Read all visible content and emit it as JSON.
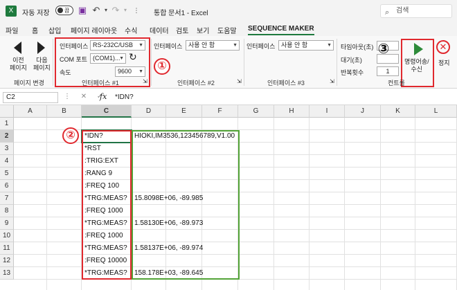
{
  "titlebar": {
    "autosave_label": "자동 저장",
    "autosave_state": "끔",
    "doc_title": "통합 문서1 - Excel",
    "search_placeholder": "검색"
  },
  "menu": [
    "파일",
    "홈",
    "삽입",
    "페이지 레이아웃",
    "수식",
    "데이터",
    "검토",
    "보기",
    "도움말",
    "SEQUENCE MAKER"
  ],
  "ribbon": {
    "nav": {
      "prev": "이전\n페이지",
      "next": "다음\n페이지",
      "group": "페이지 변경"
    },
    "if1": {
      "interface_label": "인터페이스",
      "interface_value": "RS-232C/USB",
      "com_label": "COM 포트",
      "com_value": "(COM1)...",
      "speed_label": "속도",
      "speed_value": "9600",
      "group": "인터페이스 #1"
    },
    "if2": {
      "interface_label": "인터페이스",
      "interface_value": "사용 안 함",
      "group": "인터페이스 #2"
    },
    "if3": {
      "interface_label": "인터페이스",
      "interface_value": "사용 안 함",
      "group": "인터페이스 #3"
    },
    "control": {
      "timeout_label": "타임아웃(초)",
      "wait_label": "대기(초)",
      "repeat_label": "반복횟수",
      "repeat_value": "1",
      "send_label": "명령어송/\n수신",
      "stop_label": "정지",
      "group": "컨트롤"
    },
    "markers": {
      "m1": "①",
      "m2": "②",
      "m3": "③"
    }
  },
  "formula": {
    "cell_ref": "C2",
    "fx": "fx",
    "value": "*IDN?"
  },
  "columns": [
    "A",
    "B",
    "C",
    "D",
    "E",
    "F",
    "G",
    "H",
    "I",
    "J",
    "K",
    "L"
  ],
  "rows": [
    "1",
    "2",
    "3",
    "4",
    "5",
    "6",
    "7",
    "8",
    "9",
    "10",
    "11",
    "12",
    "13"
  ],
  "commands": [
    "*IDN?",
    "*RST",
    ":TRIG:EXT",
    ":RANG 9",
    ":FREQ 100",
    "*TRG:MEAS?",
    ":FREQ 1000",
    "*TRG:MEAS?",
    ":FREQ 1000",
    "*TRG:MEAS?",
    ":FREQ 10000",
    "*TRG:MEAS?"
  ],
  "responses": [
    "HIOKI,IM3536,123456789,V1.00",
    "",
    "",
    "",
    "",
    "15.8098E+06, -89.985",
    "",
    "1.58130E+06, -89.973",
    "",
    "1.58137E+06, -89.974",
    "",
    "158.178E+03, -89.645"
  ]
}
